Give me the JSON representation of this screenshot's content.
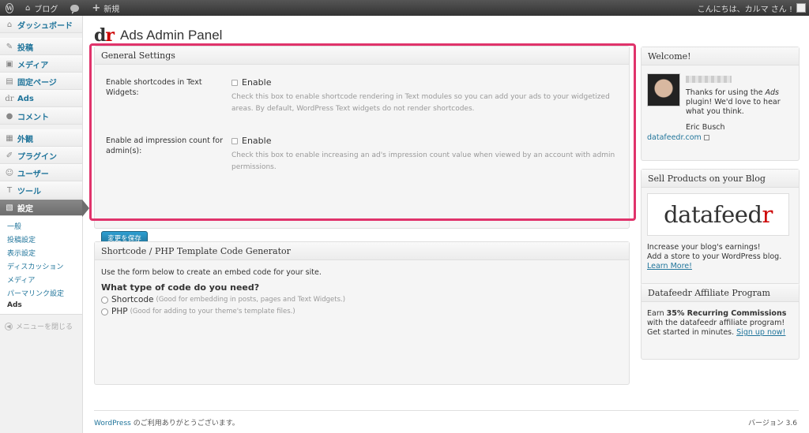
{
  "adminbar": {
    "site_name": "ブログ",
    "new_label": "新規",
    "greeting": "こんにちは、カルマ さん !"
  },
  "sidebar": {
    "dashboard": "ダッシュボード",
    "posts": "投稿",
    "media": "メディア",
    "pages": "固定ページ",
    "ads": "Ads",
    "comments": "コメント",
    "appearance": "外観",
    "plugins": "プラグイン",
    "users": "ユーザー",
    "tools": "ツール",
    "settings": "設定",
    "submenu": [
      "一般",
      "投稿設定",
      "表示設定",
      "ディスカッション",
      "メディア",
      "パーマリンク設定",
      "Ads"
    ],
    "collapse": "メニューを閉じる"
  },
  "page": {
    "logo_d": "d",
    "logo_r": "r",
    "title": "Ads Admin Panel"
  },
  "general": {
    "title": "General Settings",
    "row1_label": "Enable shortcodes in Text Widgets:",
    "row1_cb": "Enable",
    "row1_desc": "Check this box to enable shortcode rendering in Text modules so you can add your ads to your widgetized areas. By default, WordPress Text widgets do not render shortcodes.",
    "row2_label": "Enable ad impression count for admin(s):",
    "row2_cb": "Enable",
    "row2_desc": "Check this box to enable increasing an ad's impression count value when viewed by an account with admin permissions.",
    "save": "変更を保存"
  },
  "generator": {
    "title": "Shortcode / PHP Template Code Generator",
    "intro": "Use the form below to create an embed code for your site.",
    "question": "What type of code do you need?",
    "opt1": "Shortcode",
    "opt1_hint": "(Good for embedding in posts, pages and Text Widgets.)",
    "opt2": "PHP",
    "opt2_hint": "(Good for adding to your theme's template files.)"
  },
  "welcome": {
    "title": "Welcome!",
    "text_a": "Thanks for using the ",
    "text_em": "Ads",
    "text_b": " plugin! We'd love to hear what you think.",
    "signature": "Eric Busch",
    "link": "datafeedr.com"
  },
  "sell": {
    "title": "Sell Products on your Blog",
    "logo_main": "datafeed",
    "logo_r": "r",
    "line1": "Increase your blog's earnings!",
    "line2": "Add a store to your WordPress blog.",
    "link": "Learn More!"
  },
  "affiliate": {
    "title": "Datafeedr Affiliate Program",
    "text_a": "Earn ",
    "text_strong": "35% Recurring Commissions",
    "text_b": " with the datafeedr affiliate program! Get started in minutes. ",
    "link": "Sign up now!"
  },
  "footer": {
    "wp_link": "WordPress",
    "thanks": " のご利用ありがとうございます。",
    "version": "バージョン 3.6"
  }
}
